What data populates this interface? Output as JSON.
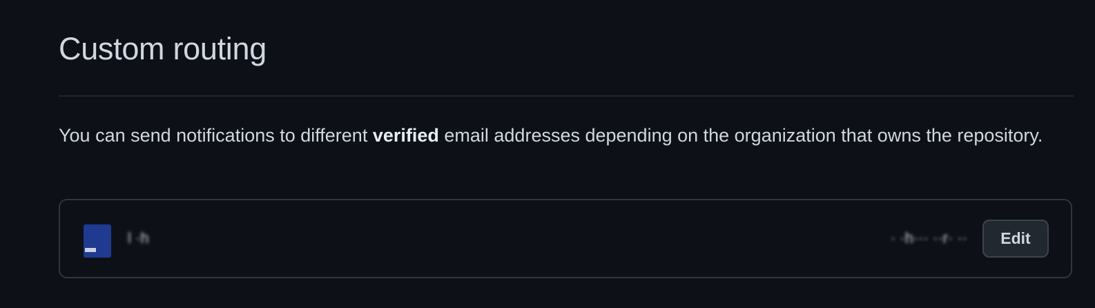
{
  "section": {
    "title": "Custom routing",
    "description_before": "You can send notifications to different ",
    "description_bold": "verified",
    "description_after": " email addresses depending on the organization that owns the repository."
  },
  "routing_entry": {
    "avatar_icon": "organization-avatar-icon",
    "org_name": "l ·h",
    "email": "· ·h··· ··r· ··",
    "edit_label": "Edit"
  },
  "colors": {
    "background": "#0d1117",
    "text": "#d1d7e0",
    "border": "#30363d",
    "button_bg": "#212830",
    "avatar": "#1f3a8f"
  }
}
